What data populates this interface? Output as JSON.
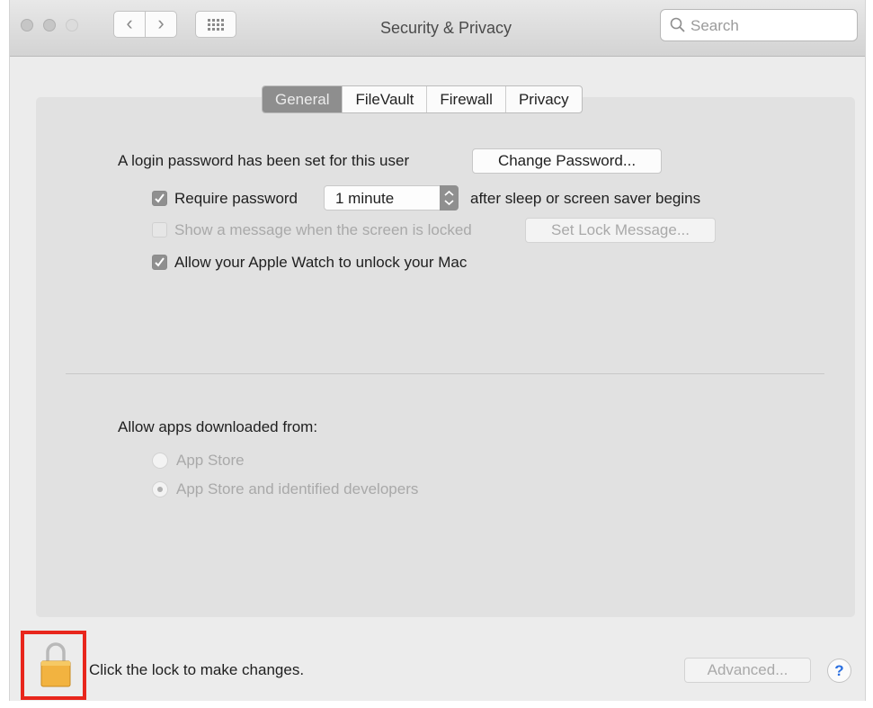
{
  "window": {
    "title": "Security & Privacy"
  },
  "toolbar": {
    "back_icon": "‹",
    "forward_icon": "›",
    "grid_icon": "grid-icon",
    "search_placeholder": "Search"
  },
  "tabs": [
    {
      "label": "General",
      "active": true
    },
    {
      "label": "FileVault",
      "active": false
    },
    {
      "label": "Firewall",
      "active": false
    },
    {
      "label": "Privacy",
      "active": false
    }
  ],
  "general": {
    "login_password_text": "A login password has been set for this user",
    "change_password_label": "Change Password...",
    "require_password": {
      "label": "Require password",
      "checked": true,
      "delay_value": "1 minute",
      "suffix": "after sleep or screen saver begins"
    },
    "show_message": {
      "label": "Show a message when the screen is locked",
      "checked": false,
      "enabled": false,
      "button_label": "Set Lock Message..."
    },
    "apple_watch": {
      "label": "Allow your Apple Watch to unlock your Mac",
      "checked": true
    }
  },
  "apps": {
    "heading": "Allow apps downloaded from:",
    "options": [
      {
        "label": "App Store",
        "selected": false
      },
      {
        "label": "App Store and identified developers",
        "selected": true
      }
    ]
  },
  "footer": {
    "lock_text": "Click the lock to make changes.",
    "advanced_label": "Advanced...",
    "help_label": "?"
  },
  "colors": {
    "highlight_box": "#e8261c",
    "lock_body": "#f2b340",
    "active_tab": "#8e8e8e"
  }
}
